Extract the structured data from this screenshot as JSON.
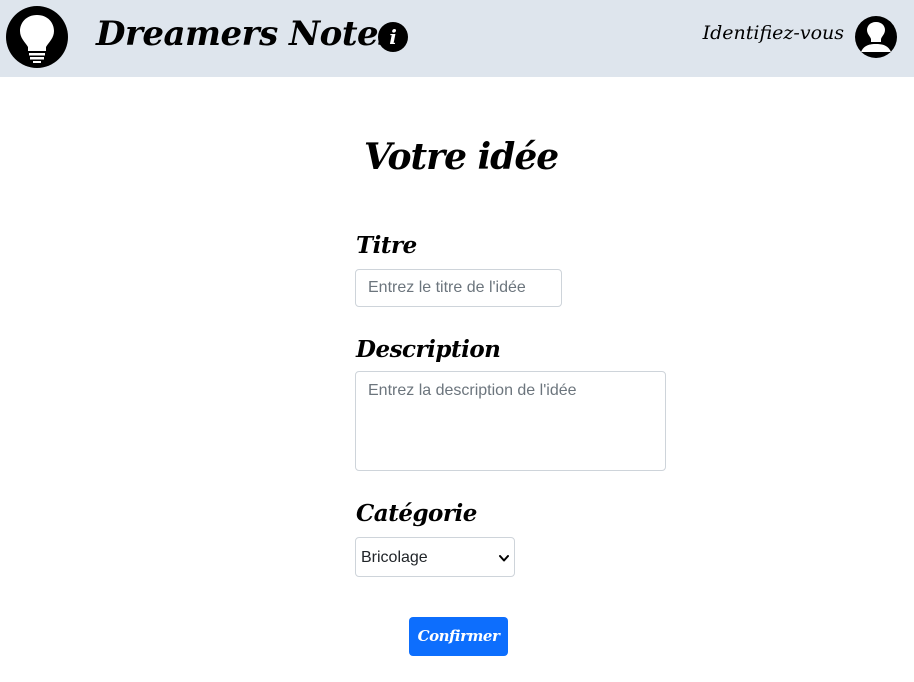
{
  "navbar": {
    "logo_icon": "lightbulb-icon",
    "brand": "Dreamers Notes",
    "info_icon": "info-icon",
    "info_glyph": "i",
    "login_label": "Identifiez-vous",
    "avatar_icon": "user-lightbulb-icon",
    "background": "#dee5ed"
  },
  "main": {
    "title": "Votre idée",
    "form": {
      "title_label": "Titre",
      "title_placeholder": "Entrez le titre de l'idée",
      "title_value": "",
      "description_label": "Description",
      "description_placeholder": "Entrez la description de l'idée",
      "description_value": "",
      "category_label": "Catégorie",
      "category_selected": "Bricolage",
      "submit_label": "Confirmer",
      "submit_color": "#0d6efd"
    }
  }
}
